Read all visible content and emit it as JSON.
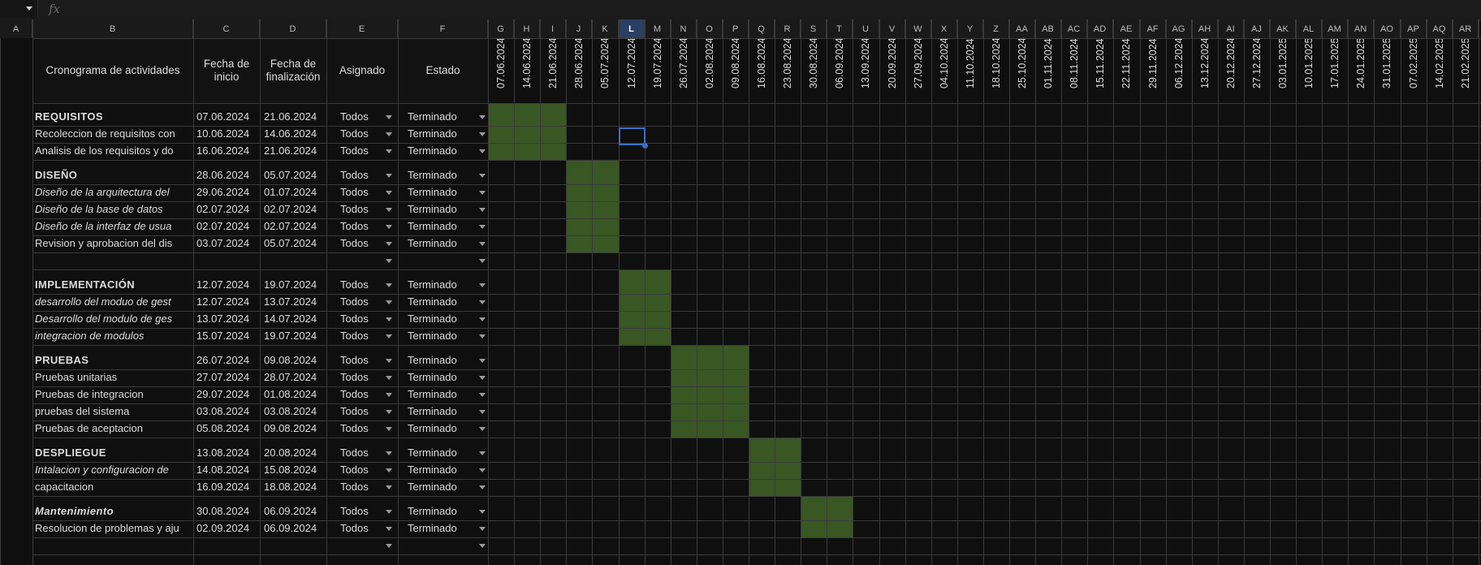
{
  "formula_bar": {
    "fx_label": "fx",
    "name_box_value": ""
  },
  "columns": {
    "letters": [
      "A",
      "B",
      "C",
      "D",
      "E",
      "F",
      "G",
      "H",
      "I",
      "J",
      "K",
      "L",
      "M",
      "N",
      "O",
      "P",
      "Q",
      "R",
      "S",
      "T",
      "U",
      "V",
      "W",
      "X",
      "Y",
      "Z",
      "AA",
      "AB",
      "AC",
      "AD",
      "AE",
      "AF",
      "AG",
      "AH",
      "AI",
      "AJ",
      "AK",
      "AL",
      "AM",
      "AN",
      "AO",
      "AP",
      "AQ",
      "AR"
    ],
    "selected": "L"
  },
  "headers": {
    "activity": "Cronograma de actividades",
    "start": "Fecha de inicio",
    "end": "Fecha de finalización",
    "assigned": "Asignado",
    "status": "Estado"
  },
  "timeline": [
    "07.06.2024",
    "14.06.2024",
    "21.06.2024",
    "28.06.2024",
    "05.07.2024",
    "12.07.2024",
    "19.07.2024",
    "26.07.2024",
    "02.08.2024",
    "09.08.2024",
    "16.08.2024",
    "23.08.2024",
    "30.08.2024",
    "06.09.2024",
    "13.09.2024",
    "20.09.2024",
    "27.09.2024",
    "04.10.2024",
    "11.10.2024",
    "18.10.2024",
    "25.10.2024",
    "01.11.2024",
    "08.11.2024",
    "15.11.2024",
    "22.11.2024",
    "29.11.2024",
    "06.12.2024",
    "13.12.2024",
    "20.12.2024",
    "27.12.2024",
    "03.01.2025",
    "10.01.2025",
    "17.01.2025",
    "24.01.2025",
    "31.01.2025",
    "07.02.2025",
    "14.02.2025",
    "21.02.2025"
  ],
  "rows": [
    {
      "name": "REQUISITOS",
      "start": "07.06.2024",
      "end": "21.06.2024",
      "assigned": "Todos",
      "status": "Terminado",
      "style": "bold",
      "bar": [
        0,
        3
      ]
    },
    {
      "name": "Recoleccion de requisitos con",
      "start": "10.06.2024",
      "end": "14.06.2024",
      "assigned": "Todos",
      "status": "Terminado",
      "style": "normal",
      "bar": [
        0,
        3
      ]
    },
    {
      "name": "Analisis de los requisitos y do",
      "start": "16.06.2024",
      "end": "21.06.2024",
      "assigned": "Todos",
      "status": "Terminado",
      "style": "normal",
      "bar": [
        0,
        3
      ]
    },
    {
      "name": "DISEÑO",
      "start": "28.06.2024",
      "end": "05.07.2024",
      "assigned": "Todos",
      "status": "Terminado",
      "style": "bold",
      "bar": [
        3,
        5
      ]
    },
    {
      "name": "Diseño de la arquitectura del",
      "start": "29.06.2024",
      "end": "01.07.2024",
      "assigned": "Todos",
      "status": "Terminado",
      "style": "italic",
      "bar": [
        3,
        5
      ]
    },
    {
      "name": "Diseño de la base de datos",
      "start": "02.07.2024",
      "end": "02.07.2024",
      "assigned": "Todos",
      "status": "Terminado",
      "style": "italic",
      "bar": [
        3,
        5
      ]
    },
    {
      "name": "Diseño de la interfaz de usua",
      "start": "02.07.2024",
      "end": "02.07.2024",
      "assigned": "Todos",
      "status": "Terminado",
      "style": "italic",
      "bar": [
        3,
        5
      ]
    },
    {
      "name": "Revision y aprobacion del dis",
      "start": "03.07.2024",
      "end": "05.07.2024",
      "assigned": "Todos",
      "status": "Terminado",
      "style": "normal",
      "bar": [
        3,
        5
      ]
    },
    {
      "name": "",
      "start": "",
      "end": "",
      "assigned": "",
      "status": "",
      "style": "normal",
      "bar": null
    },
    {
      "name": "IMPLEMENTACIÓN",
      "start": "12.07.2024",
      "end": "19.07.2024",
      "assigned": "Todos",
      "status": "Terminado",
      "style": "bold",
      "bar": [
        5,
        7
      ]
    },
    {
      "name": "desarrollo del moduo de gest",
      "start": "12.07.2024",
      "end": "13.07.2024",
      "assigned": "Todos",
      "status": "Terminado",
      "style": "italic",
      "bar": [
        5,
        7
      ]
    },
    {
      "name": "Desarrollo del modulo de ges",
      "start": "13.07.2024",
      "end": "14.07.2024",
      "assigned": "Todos",
      "status": "Terminado",
      "style": "italic",
      "bar": [
        5,
        7
      ]
    },
    {
      "name": "integracion de modulos",
      "start": "15.07.2024",
      "end": "19.07.2024",
      "assigned": "Todos",
      "status": "Terminado",
      "style": "italic",
      "bar": [
        5,
        7
      ]
    },
    {
      "name": "PRUEBAS",
      "start": "26.07.2024",
      "end": "09.08.2024",
      "assigned": "Todos",
      "status": "Terminado",
      "style": "bold",
      "bar": [
        7,
        10
      ]
    },
    {
      "name": "Pruebas unitarias",
      "start": "27.07.2024",
      "end": "28.07.2024",
      "assigned": "Todos",
      "status": "Terminado",
      "style": "normal",
      "bar": [
        7,
        10
      ]
    },
    {
      "name": "Pruebas de integracion",
      "start": "29.07.2024",
      "end": "01.08.2024",
      "assigned": "Todos",
      "status": "Terminado",
      "style": "normal",
      "bar": [
        7,
        10
      ]
    },
    {
      "name": "pruebas del sistema",
      "start": "03.08.2024",
      "end": "03.08.2024",
      "assigned": "Todos",
      "status": "Terminado",
      "style": "normal",
      "bar": [
        7,
        10
      ]
    },
    {
      "name": "Pruebas de aceptacion",
      "start": "05.08.2024",
      "end": "09.08.2024",
      "assigned": "Todos",
      "status": "Terminado",
      "style": "normal",
      "bar": [
        7,
        10
      ]
    },
    {
      "name": "DESPLIEGUE",
      "start": "13.08.2024",
      "end": "20.08.2024",
      "assigned": "Todos",
      "status": "Terminado",
      "style": "bold",
      "bar": [
        10,
        12
      ]
    },
    {
      "name": "Intalacion y configuracion de",
      "start": "14.08.2024",
      "end": "15.08.2024",
      "assigned": "Todos",
      "status": "Terminado",
      "style": "italic",
      "bar": [
        10,
        12
      ]
    },
    {
      "name": "capacitacion",
      "start": "16.09.2024",
      "end": "18.08.2024",
      "assigned": "Todos",
      "status": "Terminado",
      "style": "normal",
      "bar": [
        10,
        12
      ]
    },
    {
      "name": "Mantenimiento",
      "start": "30.08.2024",
      "end": "06.09.2024",
      "assigned": "Todos",
      "status": "Terminado",
      "style": "bolditalic",
      "bar": [
        12,
        14
      ]
    },
    {
      "name": "Resolucion de problemas y aju",
      "start": "02.09.2024",
      "end": "06.09.2024",
      "assigned": "Todos",
      "status": "Terminado",
      "style": "normal",
      "bar": [
        12,
        14
      ]
    },
    {
      "name": "",
      "start": "",
      "end": "",
      "assigned": "",
      "status": "",
      "style": "normal",
      "bar": null
    }
  ],
  "colors": {
    "bar": "#385723",
    "gridline": "#3a3a3a",
    "selection": "#3d6fc2",
    "background": "#0f0f0f"
  }
}
